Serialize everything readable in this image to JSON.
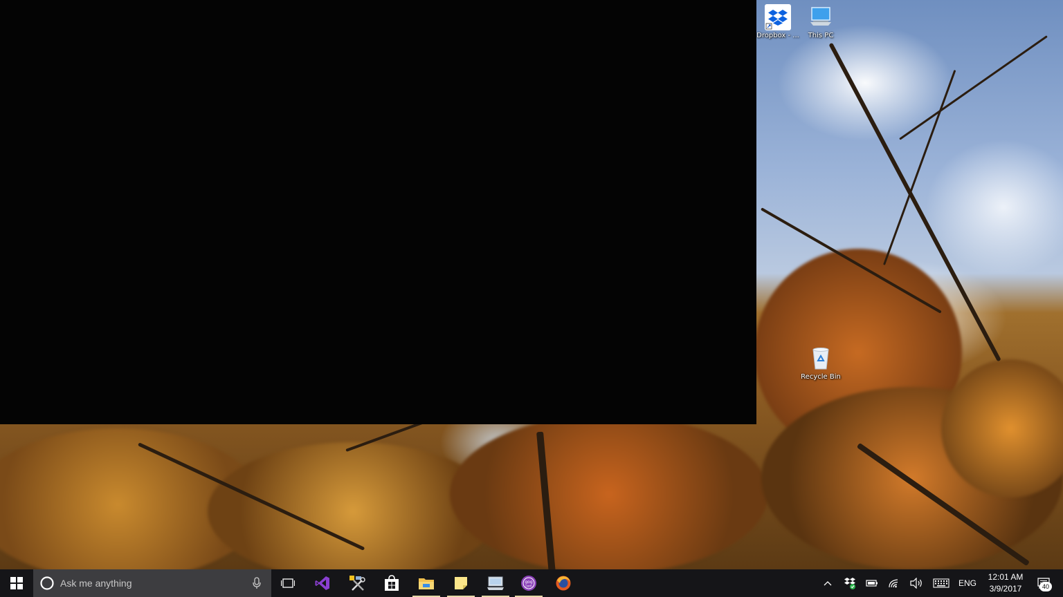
{
  "desktop": {
    "icons": [
      {
        "label": "Dropbox - ...",
        "icon": "dropbox-icon"
      },
      {
        "label": "This PC",
        "icon": "this-pc-icon"
      },
      {
        "label": "Recycle Bin",
        "icon": "recycle-bin-icon"
      }
    ]
  },
  "taskbar": {
    "start_icon": "windows-logo-icon",
    "search": {
      "placeholder": "Ask me anything",
      "cortana_icon": "cortana-circle-icon",
      "mic_icon": "microphone-icon"
    },
    "task_view_icon": "task-view-icon",
    "apps": [
      {
        "name": "Visual Studio",
        "icon": "visual-studio-icon",
        "running": false
      },
      {
        "name": "Tools",
        "icon": "tools-icon",
        "running": false
      },
      {
        "name": "Store",
        "icon": "store-icon",
        "running": false
      },
      {
        "name": "File Explorer",
        "icon": "file-explorer-icon",
        "running": true
      },
      {
        "name": "Sticky Notes",
        "icon": "sticky-notes-icon",
        "running": true
      },
      {
        "name": "Remote Desktop",
        "icon": "remote-desktop-icon",
        "running": true
      },
      {
        "name": "GOG Galaxy",
        "icon": "gog-icon",
        "running": true
      },
      {
        "name": "Firefox",
        "icon": "firefox-icon",
        "running": false
      }
    ],
    "tray": {
      "language": "ENG",
      "time": "12:01 AM",
      "date": "3/9/2017",
      "notification_count": "40"
    }
  },
  "colors": {
    "taskbar_bg": "#151518",
    "search_bg": "#3d3d40",
    "running_underline": "#e6d9a8"
  }
}
